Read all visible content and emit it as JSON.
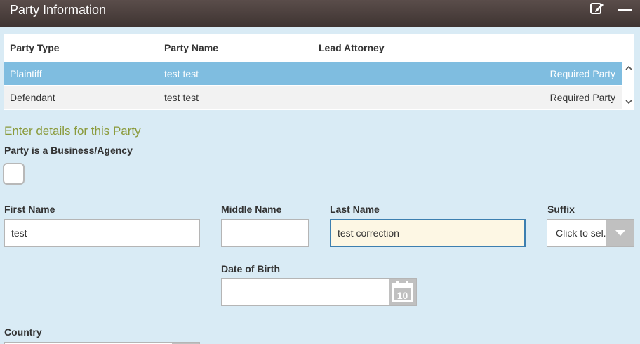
{
  "header": {
    "title": "Party Information",
    "edit_icon": "edit-icon",
    "minimize_icon": "minimize-icon"
  },
  "table": {
    "columns": [
      "Party Type",
      "Party Name",
      "Lead Attorney"
    ],
    "rows": [
      {
        "party_type": "Plaintiff",
        "party_name": "test test",
        "lead_attorney": "",
        "status": "Required Party",
        "selected": true
      },
      {
        "party_type": "Defendant",
        "party_name": "test test",
        "lead_attorney": "",
        "status": "Required Party",
        "selected": false
      }
    ]
  },
  "form": {
    "section_title": "Enter details for this Party",
    "business_label": "Party is a Business/Agency",
    "business_checked": false,
    "first_name_label": "First Name",
    "first_name_value": "test",
    "middle_name_label": "Middle Name",
    "middle_name_value": "",
    "last_name_label": "Last Name",
    "last_name_value": "test correction",
    "suffix_label": "Suffix",
    "suffix_value": "Click to sel...",
    "dob_label": "Date of Birth",
    "dob_value": "",
    "calendar_day": "10",
    "country_label": "Country",
    "country_value": ""
  },
  "colors": {
    "background": "#d9ebf5",
    "header": "#4a3f3c",
    "selected_row": "#7fbde0",
    "section_title": "#8a9a3b",
    "active_input": "#fdf7e4"
  }
}
